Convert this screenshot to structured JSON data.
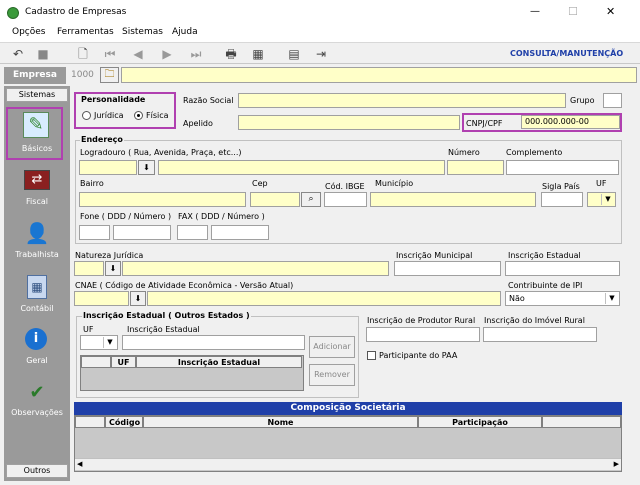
{
  "window": {
    "title": "Cadastro de Empresas",
    "minimize": "—",
    "maximize": "☐",
    "close": "✕"
  },
  "menu": [
    "Opções",
    "Ferramentas",
    "Sistemas",
    "Ajuda"
  ],
  "toolbar": {
    "mode_label": "CONSULTA/MANUTENÇÃO"
  },
  "empresa": {
    "label": "Empresa",
    "code": "1000"
  },
  "sidebar": {
    "header": "Sistemas",
    "items": [
      "Básicos",
      "Fiscal",
      "Trabalhista",
      "Contábil",
      "Geral",
      "Observações"
    ],
    "footer": "Outros"
  },
  "personalidade": {
    "title": "Personalidade",
    "option1": "Jurídica",
    "option2": "Física",
    "selected": "Física"
  },
  "labels": {
    "razao_social": "Razão Social",
    "grupo": "Grupo",
    "apelido": "Apelido",
    "cnpj_cpf": "CNPJ/CPF",
    "endereco": "Endereço",
    "logradouro": "Logradouro ( Rua, Avenida, Praça, etc...)",
    "numero": "Número",
    "complemento": "Complemento",
    "bairro": "Bairro",
    "cep": "Cep",
    "cod_ibge": "Cód. IBGE",
    "municipio": "Município",
    "sigla_pais": "Sigla País",
    "uf": "UF",
    "fone": "Fone ( DDD / Número )",
    "fax": "FAX ( DDD / Número )",
    "natureza": "Natureza Jurídica",
    "insc_municipal": "Inscrição Municipal",
    "insc_estadual": "Inscrição Estadual",
    "cnae": "CNAE ( Código de Atividade Econômica - Versão Atual)",
    "contribuinte_ipi": "Contribuinte de IPI",
    "ie_outros": "Inscrição Estadual ( Outros Estados )",
    "ie_uf": "UF",
    "ie_insc": "Inscrição Estadual",
    "prod_rural": "Inscrição de Produtor Rural",
    "imovel_rural": "Inscrição do Imóvel Rural",
    "paa": "Participante do PAA"
  },
  "values": {
    "cnpj_cpf": "000.000.000-00",
    "contribuinte_ipi": "Não"
  },
  "ie_grid": {
    "columns": [
      "UF",
      "Inscrição Estadual"
    ]
  },
  "buttons": {
    "adicionar": "Adicionar",
    "remover": "Remover"
  },
  "societaria": {
    "title": "Composição Societária",
    "columns": [
      "Código",
      "Nome",
      "Participação"
    ]
  }
}
